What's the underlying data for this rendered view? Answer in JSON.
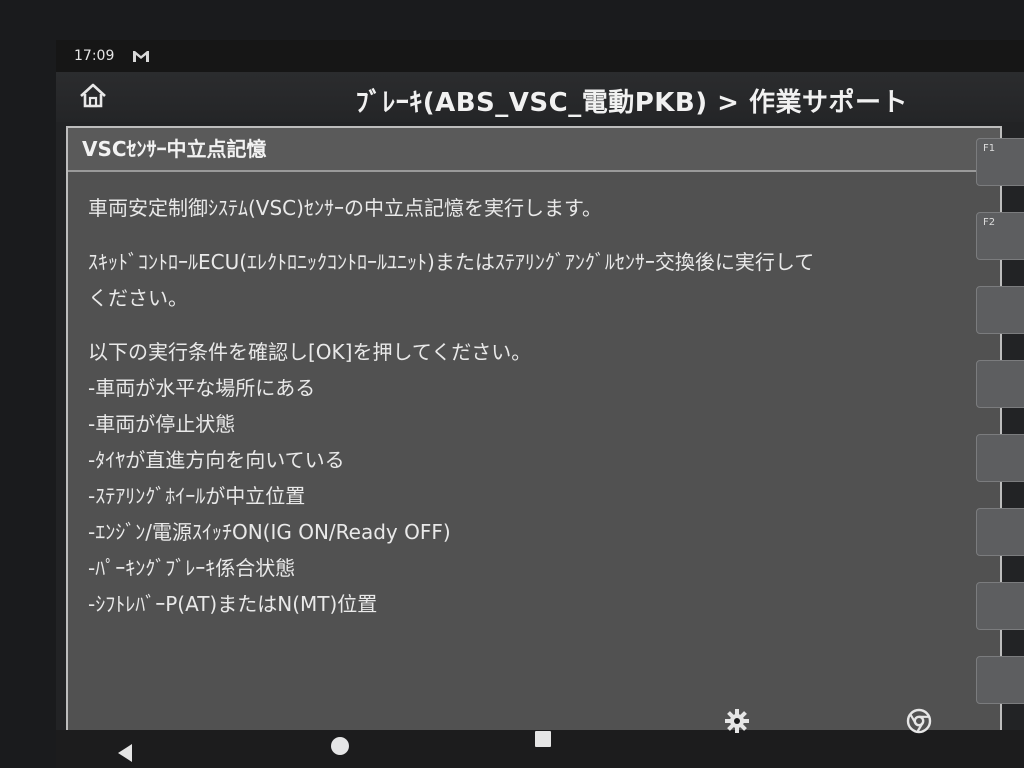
{
  "status_bar": {
    "time": "17:09",
    "notification_icon": "gmail-icon"
  },
  "header": {
    "home_icon": "home-icon",
    "title": "ﾌﾞﾚｰｷ(ABS_VSC_電動PKB) > 作業サポート"
  },
  "dialog": {
    "title": "VSCｾﾝｻｰ中立点記憶",
    "line1": "車両安定制御ｼｽﾃﾑ(VSC)ｾﾝｻｰの中立点記憶を実行します。",
    "line2a": "ｽｷｯﾄﾞｺﾝﾄﾛｰﾙECU(ｴﾚｸﾄﾛﾆｯｸｺﾝﾄﾛｰﾙﾕﾆｯﾄ)またはｽﾃｱﾘﾝｸﾞｱﾝｸﾞﾙｾﾝｻｰ交換後に実行して",
    "line2b": "ください。",
    "instruction": "以下の実行条件を確認し[OK]を押してください。",
    "conditions": [
      "-車両が水平な場所にある",
      "-車両が停止状態",
      "-ﾀｲﾔが直進方向を向いている",
      "-ｽﾃｱﾘﾝｸﾞﾎｲｰﾙが中立位置",
      "-ｴﾝｼﾞﾝ/電源ｽｲｯﾁON(IG ON/Ready OFF)",
      "-ﾊﾟｰｷﾝｸﾞﾌﾞﾚｰｷ係合状態",
      "-ｼﾌﾄﾚﾊﾞｰP(AT)またはN(MT)位置"
    ]
  },
  "function_keys": {
    "f1": "F1",
    "f2": "F2"
  },
  "nav_bar": {
    "icons": [
      "back-icon",
      "home-circle-icon",
      "recents-icon",
      "settings-gear-icon",
      "chrome-icon"
    ]
  },
  "colors": {
    "dialog_bg": "#515151",
    "header_bg": "#2b2c2e",
    "text": "#e9e9e9"
  }
}
